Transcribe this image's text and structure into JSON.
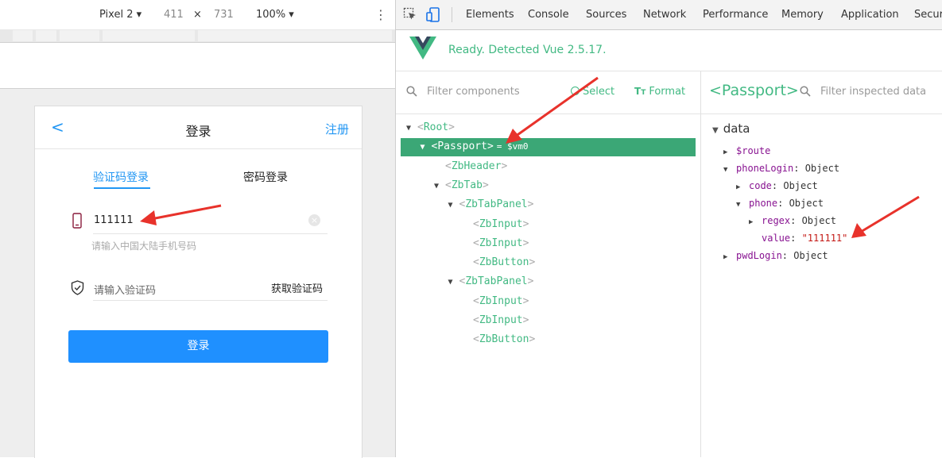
{
  "device_toolbar": {
    "device": "Pixel 2 ▾",
    "width": "411",
    "times": "×",
    "height": "731",
    "zoom": "100% ▾",
    "more": "⋮"
  },
  "phone": {
    "header": {
      "back": "<",
      "title": "登录",
      "register": "注册"
    },
    "tabs": [
      "验证码登录",
      "密码登录"
    ],
    "phone_value": "111111",
    "clear_glyph": "×",
    "phone_hint": "请输入中国大陆手机号码",
    "code_placeholder": "请输入验证码",
    "get_code": "获取验证码",
    "login_button": "登录"
  },
  "devtools": {
    "tabs": [
      "Elements",
      "Console",
      "Sources",
      "Network",
      "Performance",
      "Memory",
      "Application",
      "Securi"
    ],
    "vue_status": "Ready. Detected Vue 2.5.17.",
    "filter_components": "Filter components",
    "select_label": "Select",
    "format_label": "Format",
    "inspected_name": "<Passport>",
    "filter_inspected": "Filter inspected data",
    "selected_suffix": "= $vm0"
  },
  "component_tree": [
    {
      "name": "Root",
      "expanded": true,
      "depth": 0
    },
    {
      "name": "Passport",
      "expanded": true,
      "depth": 1,
      "selected": true
    },
    {
      "name": "ZbHeader",
      "expanded": false,
      "depth": 2
    },
    {
      "name": "ZbTab",
      "expanded": true,
      "depth": 2
    },
    {
      "name": "ZbTabPanel",
      "expanded": true,
      "depth": 3
    },
    {
      "name": "ZbInput",
      "depth": 4
    },
    {
      "name": "ZbInput",
      "depth": 4
    },
    {
      "name": "ZbButton",
      "depth": 4
    },
    {
      "name": "ZbTabPanel",
      "expanded": true,
      "depth": 3
    },
    {
      "name": "ZbInput",
      "depth": 4
    },
    {
      "name": "ZbInput",
      "depth": 4
    },
    {
      "name": "ZbButton",
      "depth": 4
    }
  ],
  "inspector": {
    "section": "data",
    "rows": [
      {
        "key": "$route",
        "value": "",
        "expanded": false,
        "depth": 0
      },
      {
        "key": "phoneLogin",
        "value": "Object",
        "expanded": true,
        "depth": 0
      },
      {
        "key": "code",
        "value": "Object",
        "expanded": false,
        "depth": 1
      },
      {
        "key": "phone",
        "value": "Object",
        "expanded": true,
        "depth": 1
      },
      {
        "key": "regex",
        "value": "Object",
        "expanded": false,
        "depth": 2
      },
      {
        "key": "value",
        "value": "\"111111\"",
        "is_string": true,
        "depth": 2
      },
      {
        "key": "pwdLogin",
        "value": "Object",
        "expanded": false,
        "depth": 0
      }
    ]
  },
  "colors": {
    "vue_green": "#42b983",
    "selected_row": "#3ba776",
    "primary_blue": "#1f90ff",
    "arrow_red": "#e8322b"
  }
}
